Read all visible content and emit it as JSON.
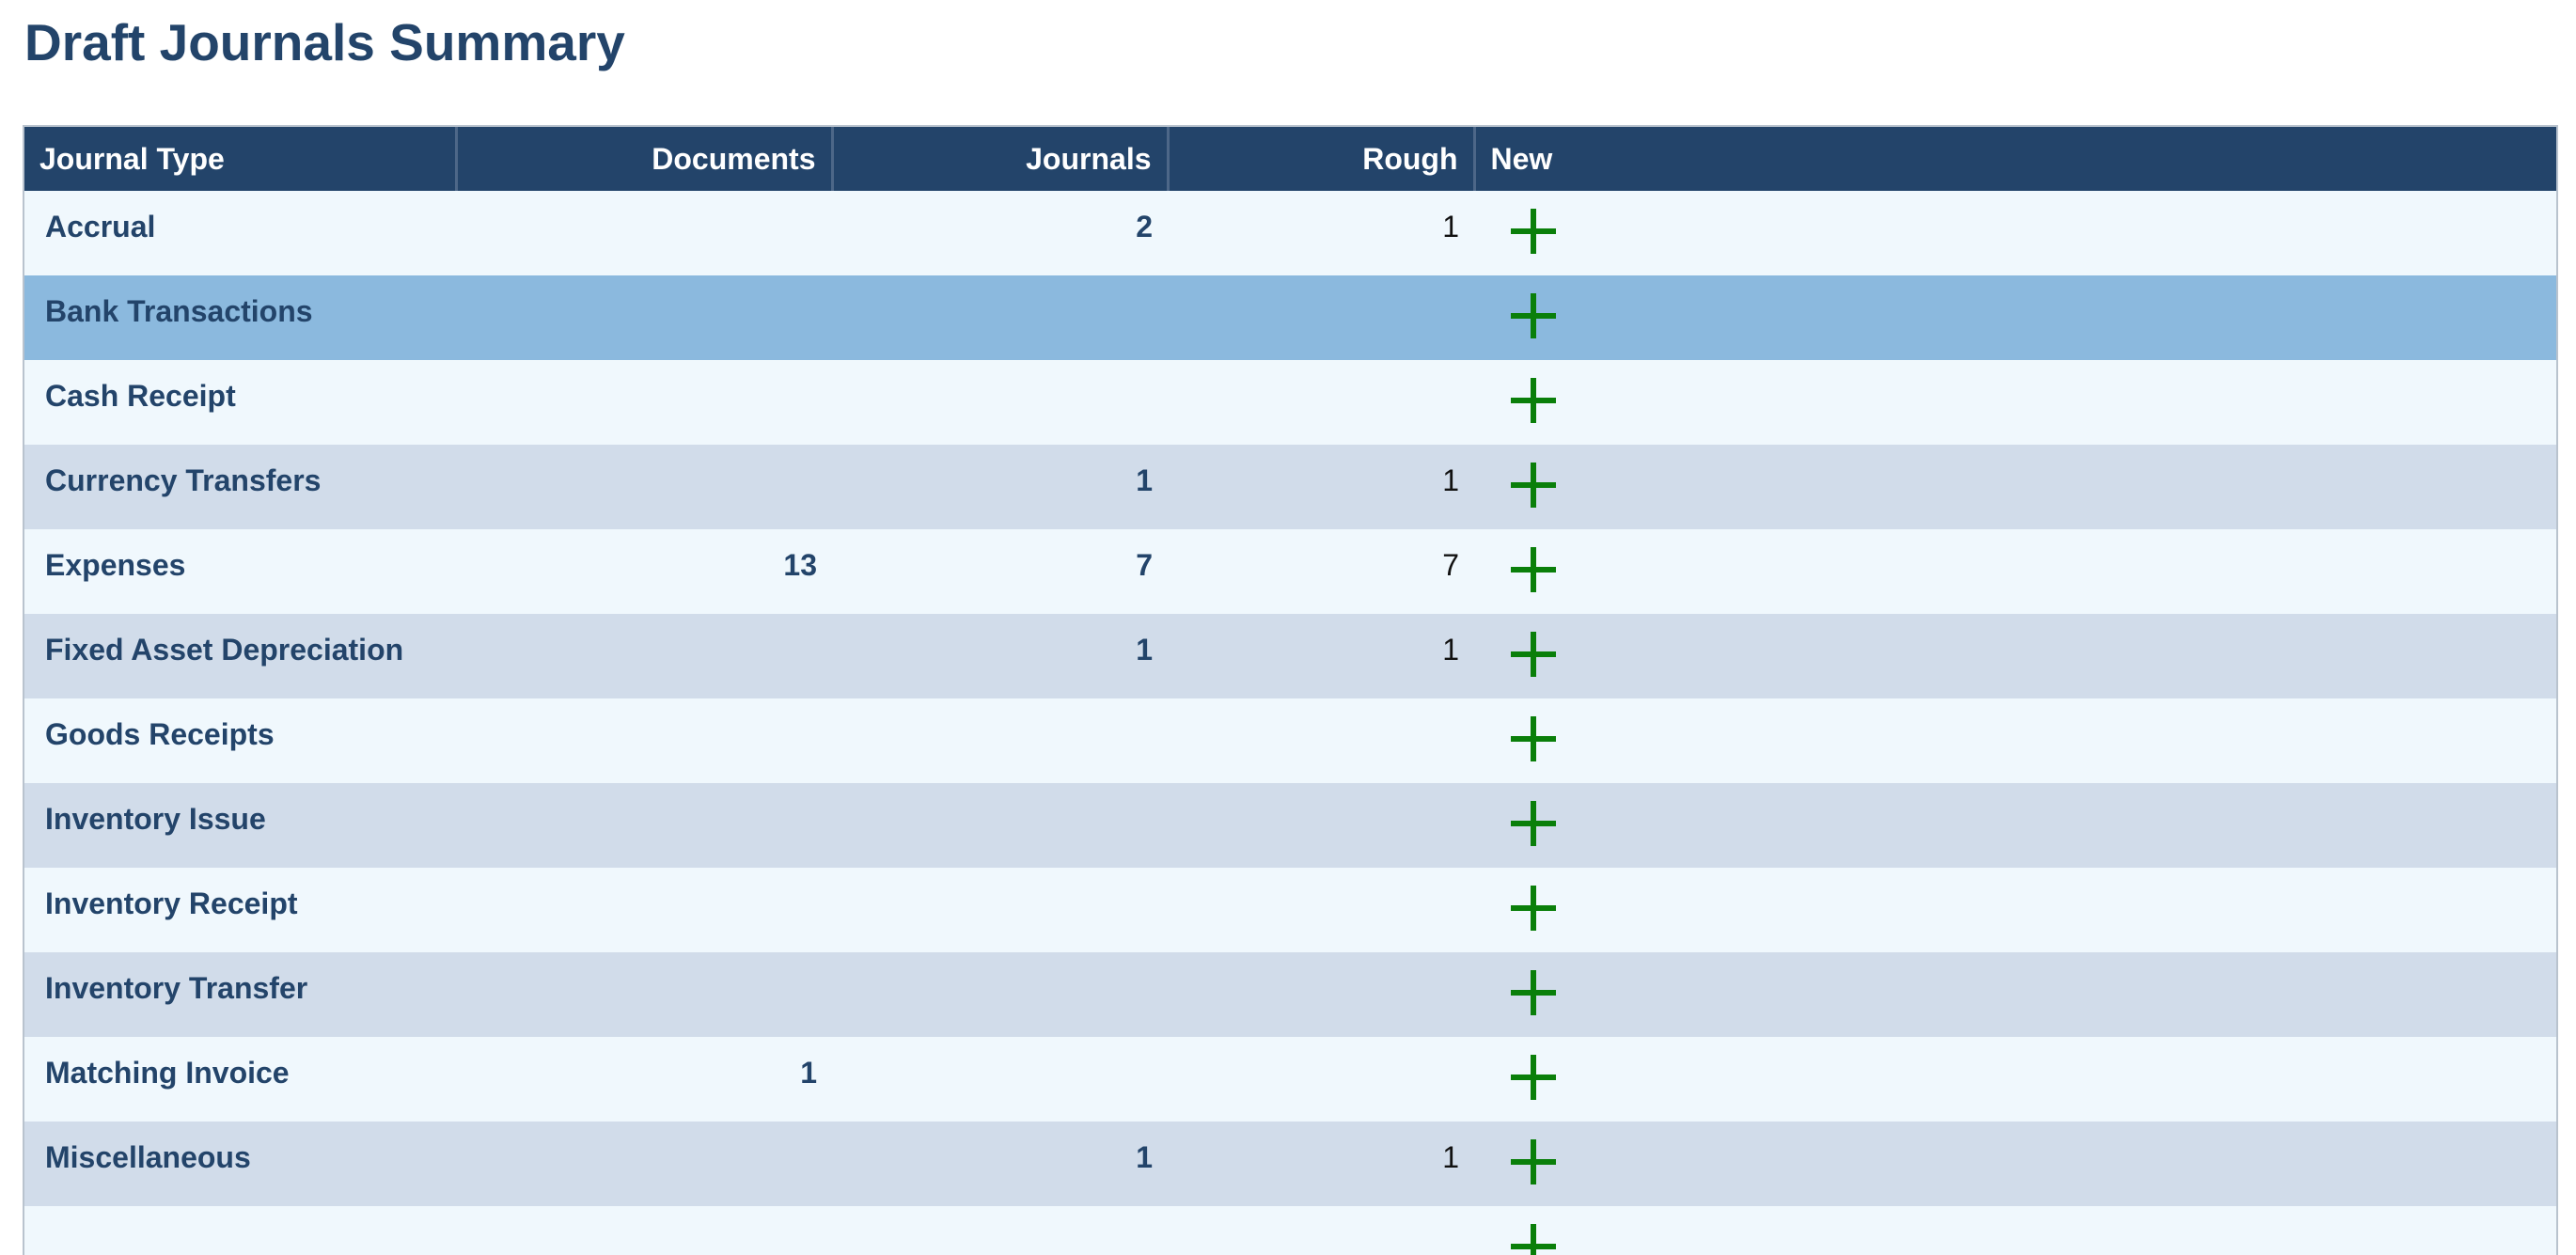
{
  "page": {
    "title": "Draft Journals Summary"
  },
  "colors": {
    "header_bg": "#23446a",
    "title": "#23446a",
    "row_light": "#f0f8fd",
    "row_dark": "#d1dcea",
    "row_selected": "#8bb9de",
    "add_icon": "#0a7f0a"
  },
  "grid": {
    "columns": [
      "Journal Type",
      "Documents",
      "Journals",
      "Rough",
      "New"
    ],
    "selected_row": "Bank Transactions",
    "add_icon": "plus-icon",
    "rows": [
      {
        "type": "Accrual",
        "documents": "",
        "journals": "2",
        "rough": "1"
      },
      {
        "type": "Bank Transactions",
        "documents": "",
        "journals": "",
        "rough": ""
      },
      {
        "type": "Cash Receipt",
        "documents": "",
        "journals": "",
        "rough": ""
      },
      {
        "type": "Currency Transfers",
        "documents": "",
        "journals": "1",
        "rough": "1"
      },
      {
        "type": "Expenses",
        "documents": "13",
        "journals": "7",
        "rough": "7"
      },
      {
        "type": "Fixed Asset Depreciation",
        "documents": "",
        "journals": "1",
        "rough": "1"
      },
      {
        "type": "Goods Receipts",
        "documents": "",
        "journals": "",
        "rough": ""
      },
      {
        "type": "Inventory Issue",
        "documents": "",
        "journals": "",
        "rough": ""
      },
      {
        "type": "Inventory Receipt",
        "documents": "",
        "journals": "",
        "rough": ""
      },
      {
        "type": "Inventory Transfer",
        "documents": "",
        "journals": "",
        "rough": ""
      },
      {
        "type": "Matching Invoice",
        "documents": "1",
        "journals": "",
        "rough": ""
      },
      {
        "type": "Miscellaneous",
        "documents": "",
        "journals": "1",
        "rough": "1"
      },
      {
        "type": "",
        "documents": "",
        "journals": "",
        "rough": ""
      }
    ]
  }
}
